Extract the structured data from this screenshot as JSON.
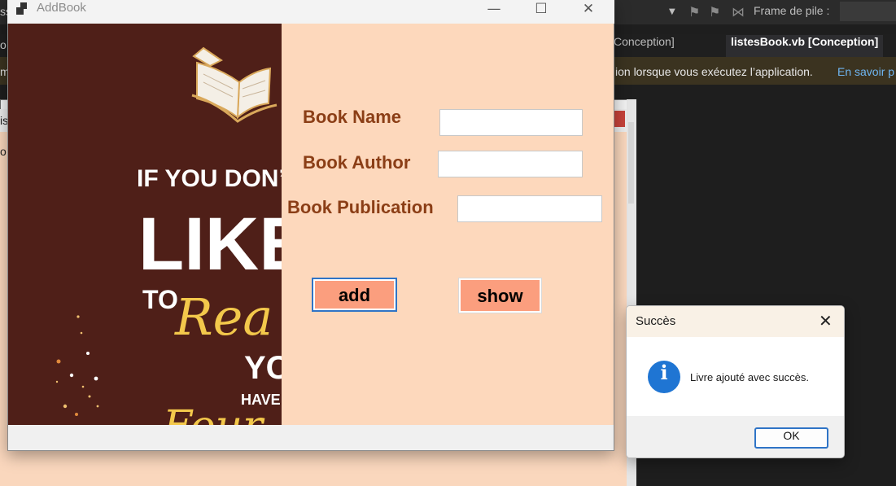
{
  "ide": {
    "toolbar_left_fragment": "ss",
    "frame_label": "Frame de pile :",
    "tab_left_fragment": "o",
    "tab_inactive": "Conception]",
    "tab_active": "listesBook.vb [Conception]",
    "info_left_fragment": "m",
    "info_text": "ion lorsque vous exécutez l’application.",
    "info_link": "En savoir p",
    "designer_title_fragment": "is",
    "designer_body_fragment": "o"
  },
  "window": {
    "title": "AddBook",
    "min_symbol": "—",
    "max_symbol": "☐",
    "close_symbol": "✕"
  },
  "poster": {
    "line1": "IF YOU DON’",
    "line2": "LIKE",
    "line3a": "TO",
    "line3b": "Rea",
    "line4": "YO",
    "line5": "HAVE",
    "line6": "Four"
  },
  "form": {
    "book_name_label": "Book Name",
    "book_author_label": "Book Author",
    "book_publication_label": "Book Publication",
    "book_name_value": "",
    "book_author_value": "",
    "book_publication_value": "",
    "add_label": "add",
    "show_label": "show"
  },
  "message_box": {
    "title": "Succès",
    "close_symbol": "✕",
    "icon_glyph": "i",
    "text": "Livre ajouté avec succès.",
    "ok_label": "OK"
  },
  "colors": {
    "poster_bg": "#4f1f18",
    "form_bg": "#fdd8bc",
    "label_color": "#8b3e16",
    "button_bg": "#fb9e7e",
    "info_icon": "#1f75d3"
  }
}
